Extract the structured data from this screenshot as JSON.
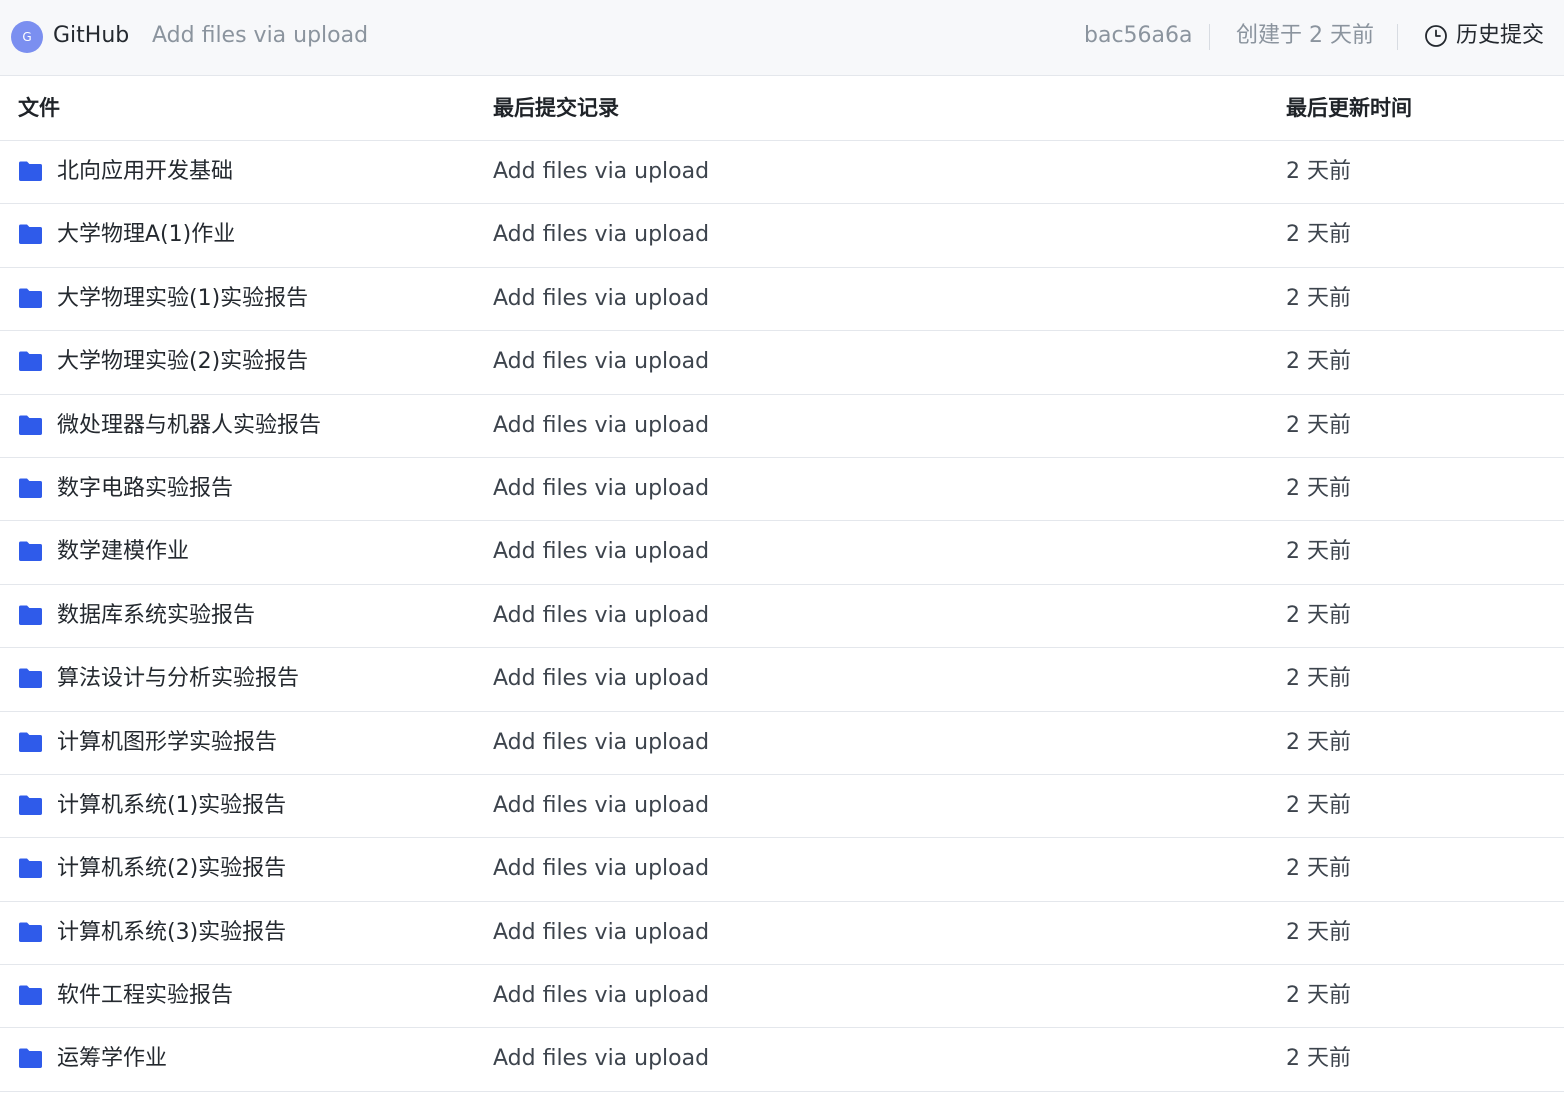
{
  "header": {
    "avatar_letter": "G",
    "author": "GitHub",
    "commit_message": "Add files via upload",
    "commit_sha": "bac56a6a",
    "created": "创建于 2 天前",
    "history_label": "历史提交",
    "history_icon": "clock-icon"
  },
  "table": {
    "columns": [
      "文件",
      "最后提交记录",
      "最后更新时间"
    ],
    "rows": [
      {
        "name": "北向应用开发基础",
        "message": "Add files via upload",
        "time": "2 天前"
      },
      {
        "name": "大学物理A(1)作业",
        "message": "Add files via upload",
        "time": "2 天前"
      },
      {
        "name": "大学物理实验(1)实验报告",
        "message": "Add files via upload",
        "time": "2 天前"
      },
      {
        "name": "大学物理实验(2)实验报告",
        "message": "Add files via upload",
        "time": "2 天前"
      },
      {
        "name": "微处理器与机器人实验报告",
        "message": "Add files via upload",
        "time": "2 天前"
      },
      {
        "name": "数字电路实验报告",
        "message": "Add files via upload",
        "time": "2 天前"
      },
      {
        "name": "数学建模作业",
        "message": "Add files via upload",
        "time": "2 天前"
      },
      {
        "name": "数据库系统实验报告",
        "message": "Add files via upload",
        "time": "2 天前"
      },
      {
        "name": "算法设计与分析实验报告",
        "message": "Add files via upload",
        "time": "2 天前"
      },
      {
        "name": "计算机图形学实验报告",
        "message": "Add files via upload",
        "time": "2 天前"
      },
      {
        "name": "计算机系统(1)实验报告",
        "message": "Add files via upload",
        "time": "2 天前"
      },
      {
        "name": "计算机系统(2)实验报告",
        "message": "Add files via upload",
        "time": "2 天前"
      },
      {
        "name": "计算机系统(3)实验报告",
        "message": "Add files via upload",
        "time": "2 天前"
      },
      {
        "name": "软件工程实验报告",
        "message": "Add files via upload",
        "time": "2 天前"
      },
      {
        "name": "运筹学作业",
        "message": "Add files via upload",
        "time": "2 天前"
      }
    ]
  },
  "icons": {
    "row_icon": "folder-icon",
    "folder_color": "#2f5bea"
  },
  "colors": {
    "header_background": "#f7f8fa",
    "muted_text": "#8b949e",
    "border": "#e4e7ec",
    "avatar": "#7b8ff0"
  }
}
